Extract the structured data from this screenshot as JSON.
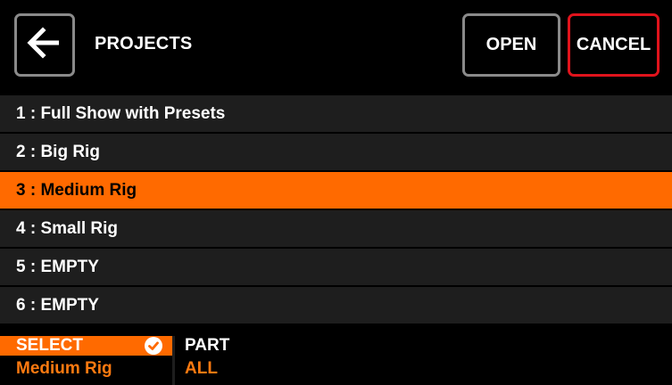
{
  "header": {
    "title": "PROJECTS",
    "back_icon": "arrow-left-icon",
    "open_label": "OPEN",
    "cancel_label": "CANCEL"
  },
  "projects": [
    {
      "label": "1 : Full Show with Presets",
      "selected": false
    },
    {
      "label": "2 : Big Rig",
      "selected": false
    },
    {
      "label": "3 : Medium Rig",
      "selected": true
    },
    {
      "label": "4 : Small Rig",
      "selected": false
    },
    {
      "label": "5 : EMPTY",
      "selected": false
    },
    {
      "label": "6 : EMPTY",
      "selected": false
    }
  ],
  "footer": {
    "select_label": "SELECT",
    "select_value": "Medium Rig",
    "select_icon": "check-circle-icon",
    "part_label": "PART",
    "part_value": "ALL"
  },
  "colors": {
    "accent": "#ff6a00",
    "cancel_border": "#e0131c",
    "button_border": "#8a8a8a",
    "row_background": "#1e1e1e"
  }
}
